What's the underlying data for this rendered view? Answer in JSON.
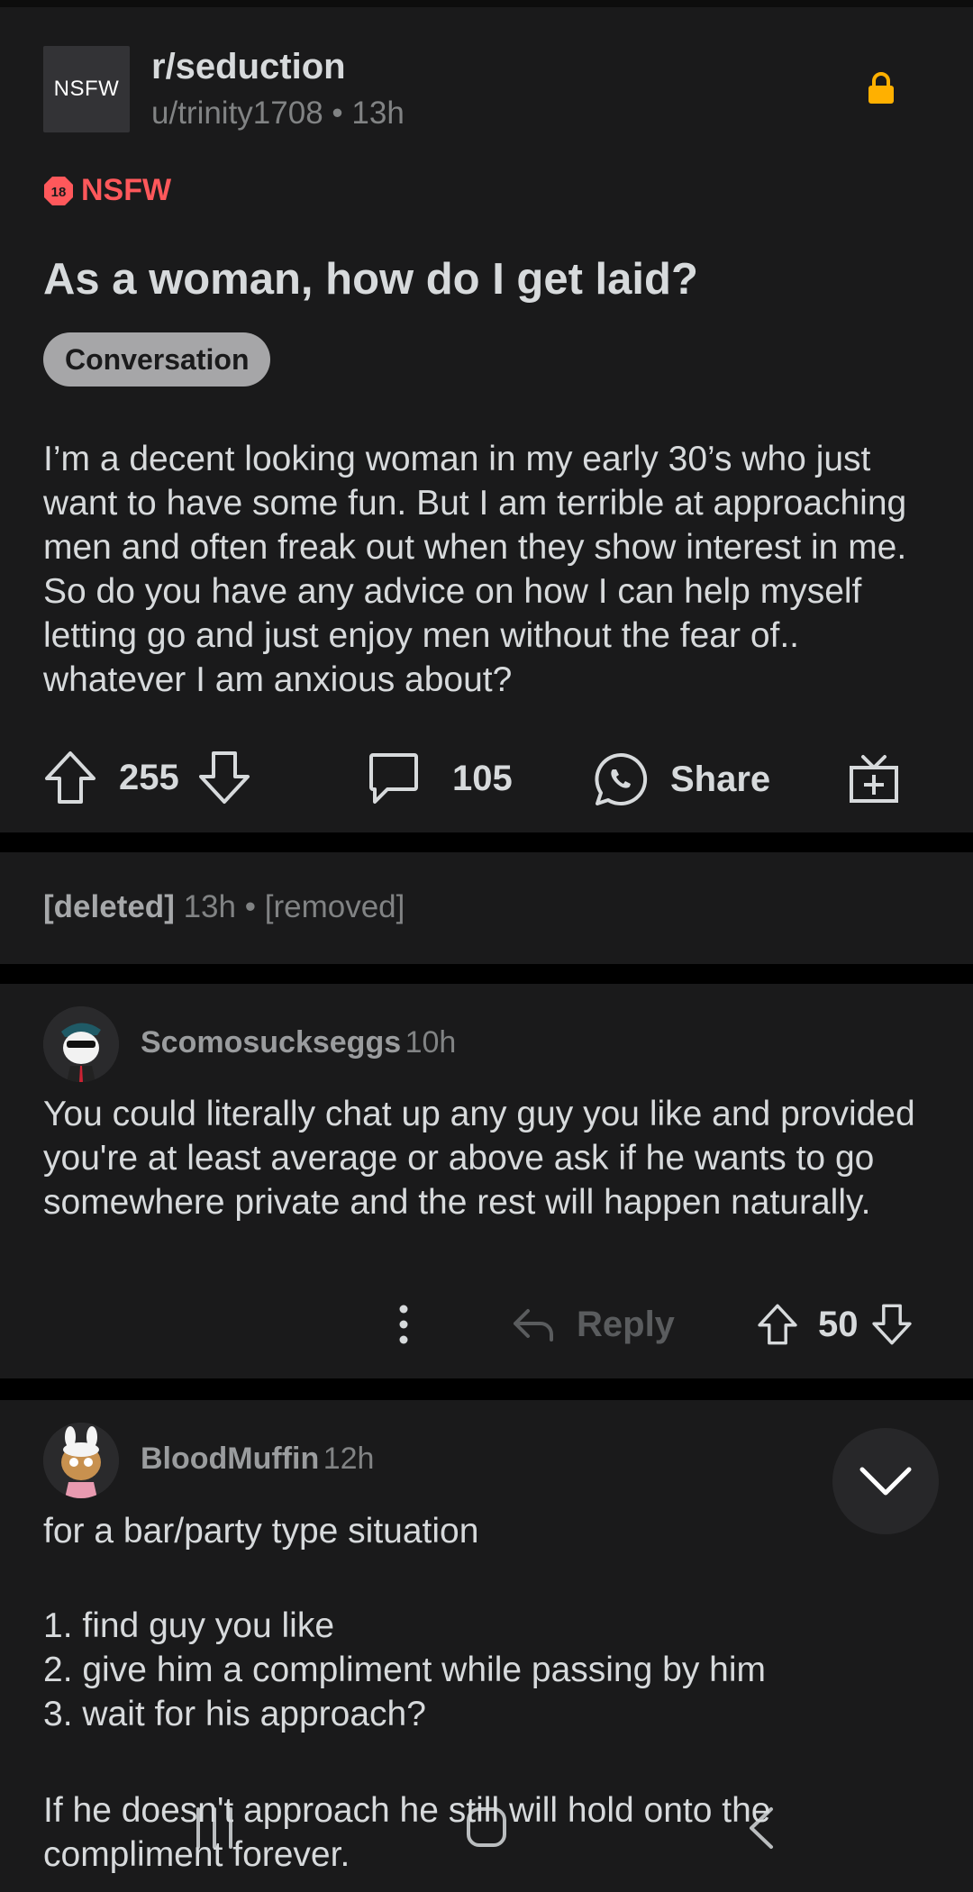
{
  "post": {
    "thumbnail_label": "NSFW",
    "subreddit": "r/seduction",
    "author": "u/trinity1708",
    "separator": "•",
    "age": "13h",
    "nsfw_tag": "NSFW",
    "nsfw_badge_number": "18",
    "title": "As a woman, how do I get laid?",
    "flair": "Conversation",
    "body": "I’m a decent looking woman in my early 30’s who just want to have some fun. But I am terrible at approaching men and often freak out when they show interest in me. So do you have any advice on how I can help myself letting go and just enjoy men without the fear of.. whatever I am anxious about?",
    "upvotes": "255",
    "comments": "105",
    "share_label": "Share"
  },
  "deleted_comment": {
    "author": "[deleted]",
    "age": "13h",
    "separator": "•",
    "content": "[removed]"
  },
  "comments": [
    {
      "username": "Scomosuckseggs",
      "age": "10h",
      "text": "You could literally chat up any guy you like and provided you're at least average or above ask if he wants to go somewhere private and the rest will happen naturally.",
      "reply_label": "Reply",
      "score": "50"
    },
    {
      "username": "BloodMuffin",
      "age": "12h",
      "line1": "for a bar/party type situation",
      "list": [
        "1. find guy you like",
        "2. give him a compliment while passing by him",
        "3. wait for his approach?"
      ],
      "closing": "If he doesn't approach he still will hold onto the compliment forever."
    }
  ],
  "icons": {
    "lock": "lock-icon",
    "upvote": "upvote-arrow-icon",
    "downvote": "downvote-arrow-icon",
    "comment": "comment-bubble-icon",
    "share": "whatsapp-icon",
    "award": "gift-icon",
    "more": "more-vertical-icon",
    "reply": "reply-arrow-icon",
    "collapse": "chevron-down-icon"
  },
  "colors": {
    "background": "#000000",
    "card": "#1a1a1b",
    "nsfw_red": "#ff585b",
    "lock_gold": "#ffb000",
    "text": "#d7dadc",
    "muted": "#818384"
  }
}
